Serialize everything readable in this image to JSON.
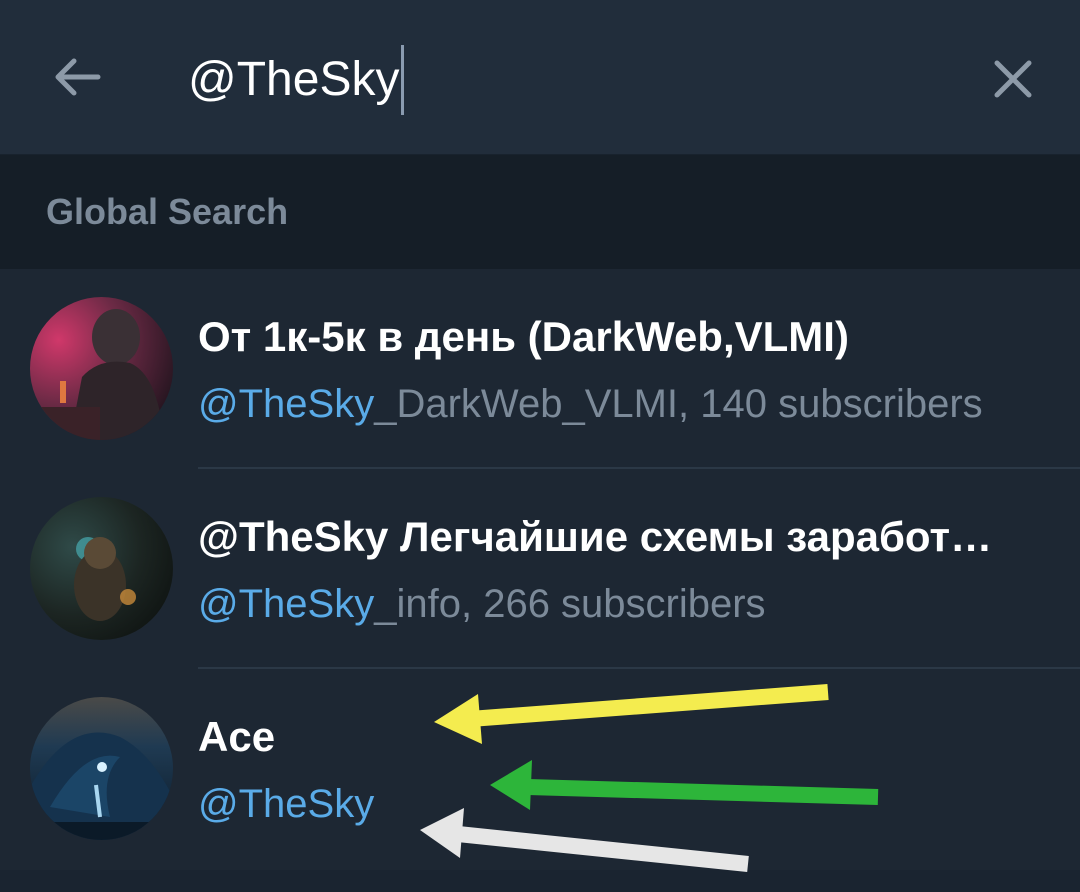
{
  "search": {
    "query": "@TheSky",
    "back_icon": "arrow-left-icon",
    "clear_icon": "close-icon"
  },
  "section": {
    "title": "Global Search"
  },
  "results": [
    {
      "title": "От 1к-5к в день (DarkWeb,VLMI)",
      "handle_match": "@TheSky",
      "handle_rest": "_DarkWeb_VLMI",
      "meta": ", 140 subscribers"
    },
    {
      "title": "@TheSky Легчайшие схемы заработ…",
      "handle_match": "@TheSky",
      "handle_rest": "_info",
      "meta": ", 266 subscribers"
    },
    {
      "title": "Ace",
      "handle_match": "@TheSky",
      "handle_rest": "",
      "meta": ""
    }
  ],
  "annotations": {
    "arrow_colors": [
      "#f4ec4f",
      "#2db53a",
      "#e6e6e6"
    ]
  },
  "colors": {
    "background": "#1d2733",
    "header": "#212d3b",
    "section": "#151e27",
    "highlight": "#5aabe8",
    "secondary_text": "#7c8a99"
  }
}
